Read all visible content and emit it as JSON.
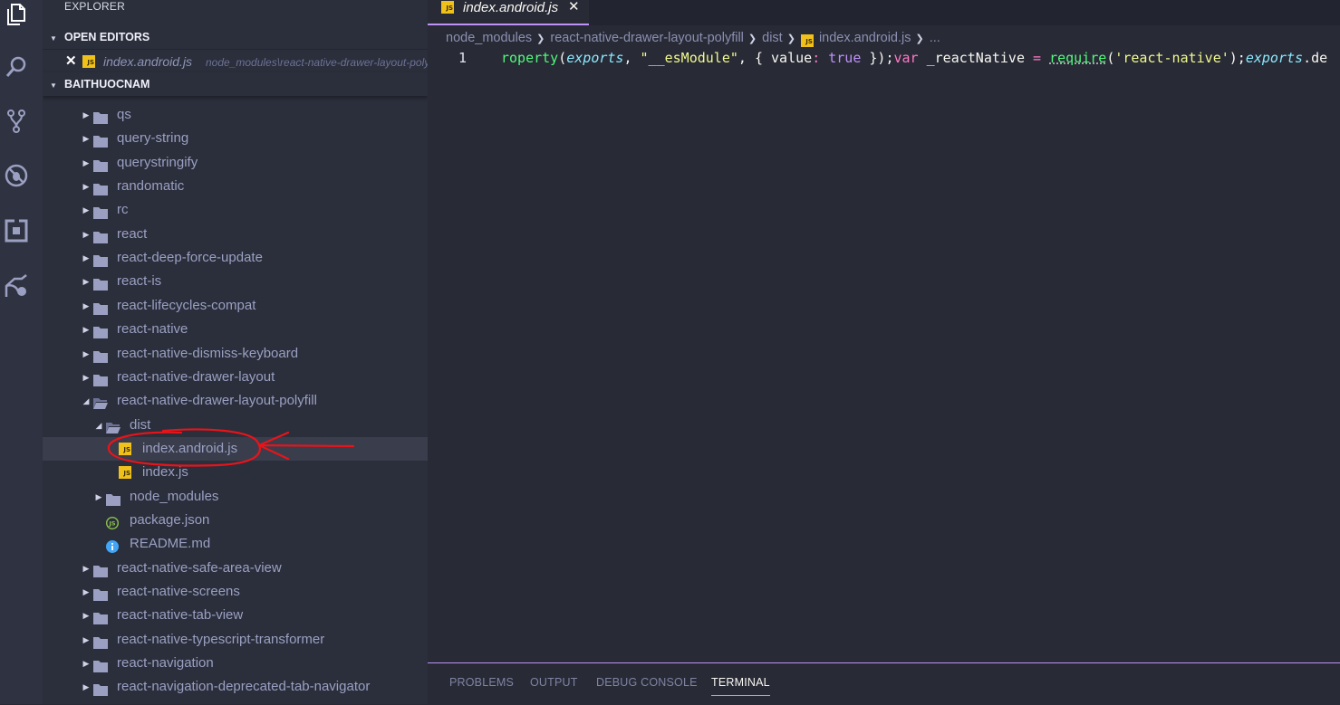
{
  "sidebar": {
    "title": "EXPLORER",
    "open_editors_header": "OPEN EDITORS",
    "open_editor": {
      "close_glyph": "✕",
      "file_name": "index.android.js",
      "path": "node_modules\\react-native-drawer-layout-polyfill\\dist"
    },
    "project_header": "BAITHUOCNAM",
    "tree": [
      {
        "label": "qs",
        "type": "folder",
        "expanded": false
      },
      {
        "label": "query-string",
        "type": "folder",
        "expanded": false
      },
      {
        "label": "querystringify",
        "type": "folder",
        "expanded": false
      },
      {
        "label": "randomatic",
        "type": "folder",
        "expanded": false
      },
      {
        "label": "rc",
        "type": "folder",
        "expanded": false
      },
      {
        "label": "react",
        "type": "folder",
        "expanded": false
      },
      {
        "label": "react-deep-force-update",
        "type": "folder",
        "expanded": false
      },
      {
        "label": "react-is",
        "type": "folder",
        "expanded": false
      },
      {
        "label": "react-lifecycles-compat",
        "type": "folder",
        "expanded": false
      },
      {
        "label": "react-native",
        "type": "folder",
        "expanded": false
      },
      {
        "label": "react-native-dismiss-keyboard",
        "type": "folder",
        "expanded": false
      },
      {
        "label": "react-native-drawer-layout",
        "type": "folder",
        "expanded": false
      },
      {
        "label": "react-native-drawer-layout-polyfill",
        "type": "folder",
        "expanded": true
      },
      {
        "label": "dist",
        "type": "folder",
        "expanded": true
      },
      {
        "label": "index.android.js",
        "type": "js",
        "selected": true
      },
      {
        "label": "index.js",
        "type": "js"
      },
      {
        "label": "node_modules",
        "type": "folder",
        "expanded": false
      },
      {
        "label": "package.json",
        "type": "json"
      },
      {
        "label": "README.md",
        "type": "info"
      },
      {
        "label": "react-native-safe-area-view",
        "type": "folder",
        "expanded": false
      },
      {
        "label": "react-native-screens",
        "type": "folder",
        "expanded": false
      },
      {
        "label": "react-native-tab-view",
        "type": "folder",
        "expanded": false
      },
      {
        "label": "react-native-typescript-transformer",
        "type": "folder",
        "expanded": false
      },
      {
        "label": "react-navigation",
        "type": "folder",
        "expanded": false
      },
      {
        "label": "react-navigation-deprecated-tab-navigator",
        "type": "folder",
        "expanded": false
      }
    ]
  },
  "editor": {
    "tab": {
      "label": "index.android.js",
      "close_glyph": "✕",
      "badge": "JS"
    },
    "breadcrumb": [
      "node_modules",
      "react-native-drawer-layout-polyfill",
      "dist",
      "index.android.js",
      "..."
    ],
    "line_number": "1",
    "code_tokens": [
      {
        "t": "roperty",
        "c": "c-fn"
      },
      {
        "t": "(",
        "c": "c-txt"
      },
      {
        "t": "exports",
        "c": "c-it"
      },
      {
        "t": ", ",
        "c": "c-txt"
      },
      {
        "t": "\"__esModule\"",
        "c": "c-str"
      },
      {
        "t": ", { ",
        "c": "c-txt"
      },
      {
        "t": "value",
        "c": "c-txt"
      },
      {
        "t": ": ",
        "c": "c-kw"
      },
      {
        "t": "true",
        "c": "c-bool"
      },
      {
        "t": " });",
        "c": "c-txt"
      },
      {
        "t": "var",
        "c": "c-kw"
      },
      {
        "t": " _reactNative ",
        "c": "c-txt"
      },
      {
        "t": "=",
        "c": "c-kw"
      },
      {
        "t": " ",
        "c": "c-txt"
      },
      {
        "t": "require",
        "c": "c-req"
      },
      {
        "t": "(",
        "c": "c-txt"
      },
      {
        "t": "'react-native'",
        "c": "c-str"
      },
      {
        "t": ");",
        "c": "c-txt"
      },
      {
        "t": "exports",
        "c": "c-it"
      },
      {
        "t": ".de",
        "c": "c-txt"
      }
    ]
  },
  "panel": {
    "tabs": [
      "PROBLEMS",
      "OUTPUT",
      "DEBUG CONSOLE",
      "TERMINAL"
    ],
    "active": "TERMINAL"
  },
  "colors": {
    "accent_purple": "#bd93f9",
    "accent_pink": "#ff79c6",
    "annotation_red": "#e8141a",
    "js_badge": "#f0c11a"
  },
  "icons": [
    "files-icon",
    "search-icon",
    "source-control-icon",
    "debug-icon",
    "extensions-icon",
    "remote-explorer-icon"
  ]
}
